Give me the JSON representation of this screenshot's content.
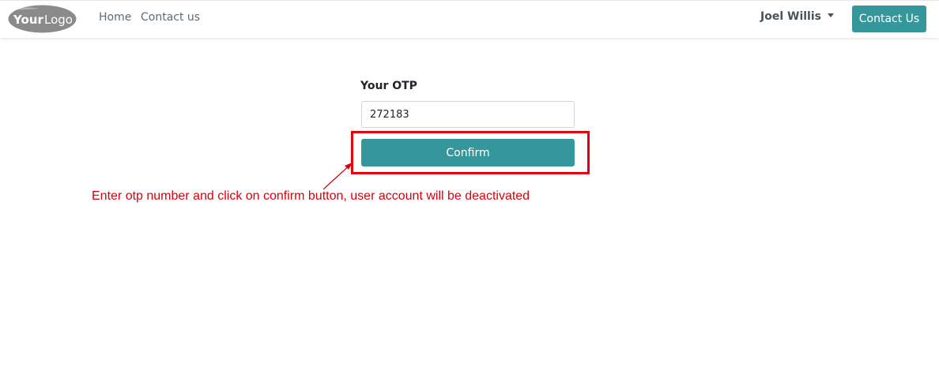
{
  "header": {
    "logo_text": "YourLogo",
    "nav": [
      {
        "label": "Home"
      },
      {
        "label": "Contact us"
      }
    ],
    "user_name": "Joel Willis",
    "contact_button": "Contact Us"
  },
  "form": {
    "otp_label": "Your OTP",
    "otp_value": "272183",
    "confirm_button": "Confirm"
  },
  "annotation": {
    "text": "Enter otp number and click on confirm button, user account will be deactivated",
    "color": "#d9000d"
  },
  "colors": {
    "primary": "#35979c",
    "highlight": "#e3000f"
  }
}
